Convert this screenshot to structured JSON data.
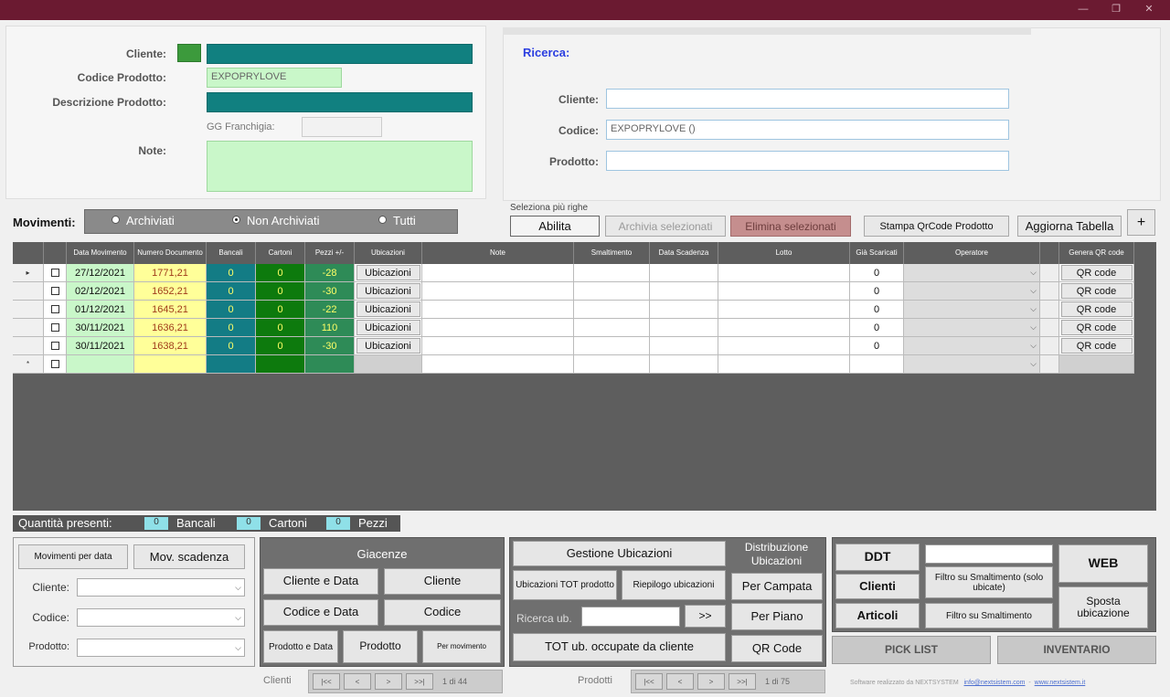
{
  "window": {
    "minimize": "—",
    "maximize": "❐",
    "close": "✕"
  },
  "top_left": {
    "cliente_label": "Cliente:",
    "codice_label": "Codice Prodotto:",
    "codice_value": "EXPOPRYLOVE",
    "descrizione_label": "Descrizione Prodotto:",
    "franchigia_label": "GG Franchigia:",
    "note_label": "Note:"
  },
  "search": {
    "title": "Ricerca:",
    "cliente_label": "Cliente:",
    "codice_label": "Codice:",
    "codice_value": "EXPOPRYLOVE ()",
    "prodotto_label": "Prodotto:"
  },
  "movimenti": {
    "label": "Movimenti:",
    "opt1": "Archiviati",
    "opt2": "Non Archiviati",
    "opt3": "Tutti"
  },
  "selection": {
    "caption": "Seleziona più righe",
    "abilita": "Abilita",
    "archivia": "Archivia selezionati",
    "elimina": "Elimina selezionati",
    "stampa": "Stampa QrCode Prodotto",
    "aggiorna": "Aggiorna Tabella",
    "plus": "+"
  },
  "grid": {
    "headers": [
      "Data Movimento",
      "Numero Documento",
      "Bancali",
      "Cartoni",
      "Pezzi +/-",
      "Ubicazioni",
      "Note",
      "Smaltimento",
      "Data Scadenza",
      "Lotto",
      "Già Scaricati",
      "Operatore",
      "Genera QR code"
    ],
    "rows": [
      {
        "data": "27/12/2021",
        "numero": "1771,21",
        "bancali": "0",
        "cartoni": "0",
        "pezzi": "-28",
        "ubicazioni": "Ubicazioni",
        "scaricati": "0",
        "qr": "QR code",
        "marker": "▸"
      },
      {
        "data": "02/12/2021",
        "numero": "1652,21",
        "bancali": "0",
        "cartoni": "0",
        "pezzi": "-30",
        "ubicazioni": "Ubicazioni",
        "scaricati": "0",
        "qr": "QR code",
        "marker": ""
      },
      {
        "data": "01/12/2021",
        "numero": "1645,21",
        "bancali": "0",
        "cartoni": "0",
        "pezzi": "-22",
        "ubicazioni": "Ubicazioni",
        "scaricati": "0",
        "qr": "QR code",
        "marker": ""
      },
      {
        "data": "30/11/2021",
        "numero": "1636,21",
        "bancali": "0",
        "cartoni": "0",
        "pezzi": "110",
        "ubicazioni": "Ubicazioni",
        "scaricati": "0",
        "qr": "QR code",
        "marker": ""
      },
      {
        "data": "30/11/2021",
        "numero": "1638,21",
        "bancali": "0",
        "cartoni": "0",
        "pezzi": "-30",
        "ubicazioni": "Ubicazioni",
        "scaricati": "0",
        "qr": "QR code",
        "marker": ""
      }
    ],
    "new_row_marker": "*"
  },
  "quantita": {
    "label": "Quantità presenti:",
    "bancali_value": "0",
    "bancali": "Bancali",
    "cartoni_value": "0",
    "cartoni": "Cartoni",
    "pezzi_value": "0",
    "pezzi": "Pezzi"
  },
  "filters": {
    "mov_data": "Movimenti per data",
    "mov_scadenza": "Mov. scadenza",
    "cliente_label": "Cliente:",
    "codice_label": "Codice:",
    "prodotto_label": "Prodotto:"
  },
  "giacenze": {
    "title": "Giacenze",
    "cliente_data": "Cliente e Data",
    "cliente": "Cliente",
    "codice_data": "Codice e Data",
    "codice": "Codice",
    "prodotto_data": "Prodotto e Data",
    "prodotto": "Prodotto",
    "per_movimento": "Per movimento"
  },
  "ubicazioni": {
    "title": "Gestione Ubicazioni",
    "tot_prodotto": "Ubicazioni TOT prodotto",
    "riepilogo": "Riepilogo ubicazioni",
    "ricerca_label": "Ricerca ub.",
    "go": ">>",
    "tot_cliente": "TOT ub. occupate da cliente"
  },
  "distribuzione": {
    "title": "Distribuzione Ubicazioni",
    "campata": "Per Campata",
    "piano": "Per Piano",
    "qr": "QR Code"
  },
  "right": {
    "ddt": "DDT",
    "clienti": "Clienti",
    "articoli": "Articoli",
    "filtro_ubicate": "Filtro su Smaltimento (solo ubicate)",
    "filtro": "Filtro su Smaltimento",
    "web": "WEB",
    "sposta": "Sposta ubicazione",
    "pick": "PICK LIST",
    "inventario": "INVENTARIO"
  },
  "nav": {
    "clienti_label": "Clienti",
    "clienti_count": "1 di 44",
    "prodotti_label": "Prodotti",
    "prodotti_count": "1 di 75",
    "first": "|<<",
    "prev": "<",
    "next": ">",
    "last": ">>|"
  },
  "footer": {
    "text": "Software realizzato da NEXTSYSTEM",
    "email": "info@nextsistem.com",
    "sep": "-",
    "site": "www.nextsistem.it"
  }
}
